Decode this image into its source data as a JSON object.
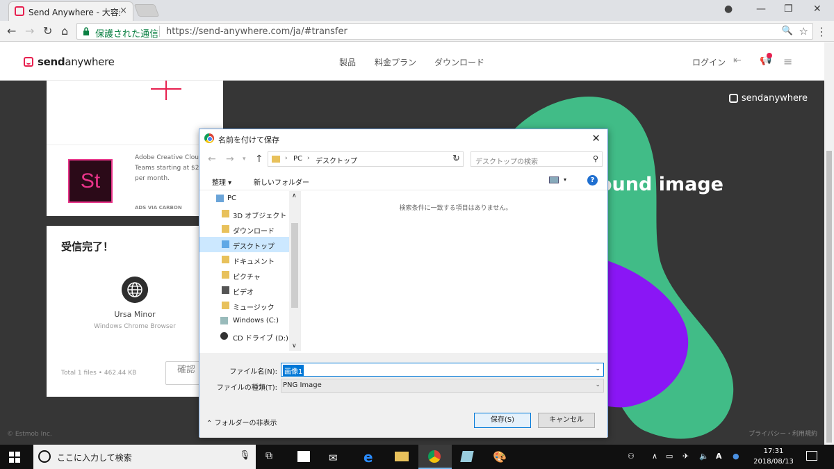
{
  "browser": {
    "tab_title": "Send Anywhere - 大容量",
    "tab_close": "×",
    "secure_label": "保護された通信",
    "url": "https://send-anywhere.com/ja/#transfer"
  },
  "site": {
    "logo_send": "send",
    "logo_anywhere": "anywhere",
    "nav": [
      "製品",
      "料金プラン",
      "ダウンロード"
    ],
    "login": "ログイン"
  },
  "stage": {
    "logo": "sendanywhere",
    "bg_text": "ound image",
    "footer_left": "© Estmob Inc.",
    "footer_right": "プライバシー・利用規約"
  },
  "ad": {
    "logo_text": "St",
    "line1": "Adobe Creative Clou",
    "line2": "Teams starting at $2",
    "line3": "per month.",
    "via": "ADS VIA CARBON"
  },
  "receive": {
    "title": "受信完了！",
    "device_name": "Ursa Minor",
    "device_sub": "Windows Chrome Browser",
    "total": "Total 1 files • 462.44 KB",
    "confirm": "確認"
  },
  "dialog": {
    "title": "名前を付けて保存",
    "path_pc": "PC",
    "path_desktop": "デスクトップ",
    "search_placeholder": "デスクトップの検索",
    "organize": "整理 ▾",
    "new_folder": "新しいフォルダー",
    "tree": [
      {
        "label": "PC"
      },
      {
        "label": "3D オブジェクト"
      },
      {
        "label": "ダウンロード"
      },
      {
        "label": "デスクトップ"
      },
      {
        "label": "ドキュメント"
      },
      {
        "label": "ピクチャ"
      },
      {
        "label": "ビデオ"
      },
      {
        "label": "ミュージック"
      },
      {
        "label": "Windows (C:)"
      },
      {
        "label": "CD ドライブ (D:) W"
      }
    ],
    "empty_message": "検索条件に一致する項目はありません。",
    "filename_label": "ファイル名(N):",
    "filename_value": "画像1",
    "filetype_label": "ファイルの種類(T):",
    "filetype_value": "PNG Image",
    "hide_folders": "フォルダーの非表示",
    "save": "保存(S)",
    "cancel": "キャンセル"
  },
  "taskbar": {
    "search_placeholder": "ここに入力して検索",
    "ime": "A",
    "time": "17:31",
    "date": "2018/08/13"
  },
  "colors": {
    "brand": "#e7204f",
    "stage_bg": "#363636",
    "blob_green": "#41bc87",
    "blob_purple": "#8a16f5",
    "dialog_accent": "#0078d7"
  }
}
